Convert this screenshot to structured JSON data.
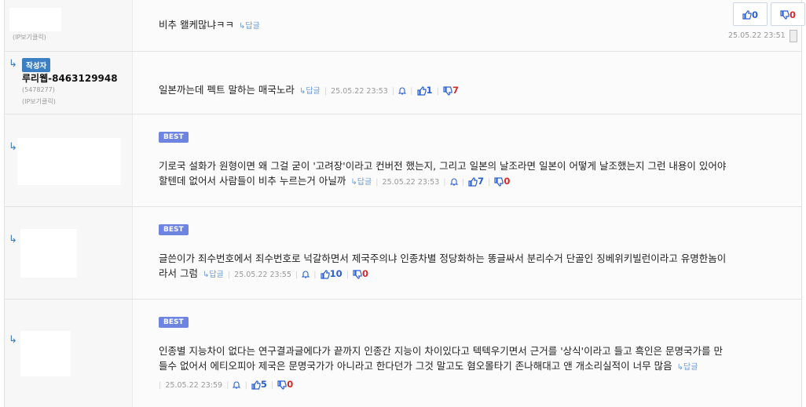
{
  "comments": [
    {
      "ip_label": "(IP보기클릭)",
      "text": "비추 왤케많냐ㅋㅋ",
      "reply_label": "답글",
      "date": "25.05.22 23:51",
      "up": "0",
      "down": "0"
    },
    {
      "badge": "작성자",
      "username": "루리웹-8463129948",
      "user_id": "(5478277)",
      "ip_label": "(IP보기클릭)",
      "text": "일본까는데 펙트 말하는 매국노라",
      "reply_label": "답글",
      "date": "25.05.22 23:53",
      "up": "1",
      "down": "7"
    },
    {
      "best": "BEST",
      "line1": "기로국 설화가 원형이면 왜 그걸 굳이 '고려장'이라고 컨버전 했는지, 그리고 일본의 날조라면 일본이 어떻게 날조했는지 그런 내용이 있어야",
      "line2": "할텐데 없어서 사람들이 비추 누르는거 아닐까",
      "reply_label": "답글",
      "date": "25.05.22 23:53",
      "up": "7",
      "down": "0"
    },
    {
      "best": "BEST",
      "line1": "글쓴이가 죄수번호에서 죄수번호로 넉갈하면서 제국주의냐 인종차별 정당화하는 똥글싸서 분리수거 단골인 징베위키빌런이라고 유명한놈이",
      "line2": "라서 그럼",
      "reply_label": "답글",
      "date": "25.05.22 23:55",
      "up": "10",
      "down": "0"
    },
    {
      "best": "BEST",
      "line1": "인종별 지능차이 없다는 연구결과글에다가 끝까지 인종간 지능이 차이있다고 텍텍우기면서 근거를 '상식'이라고 들고 흑인은 문명국가를 만",
      "line2": "들수 없어서 에티오피아 제국은 문명국가가 아니라고 한다던가 그것 말고도 혐오몰타기 존나해대고 앤 개소리실적이 너무 많음",
      "reply_label": "답글",
      "date": "25.05.22 23:59",
      "up": "5",
      "down": "0"
    }
  ]
}
